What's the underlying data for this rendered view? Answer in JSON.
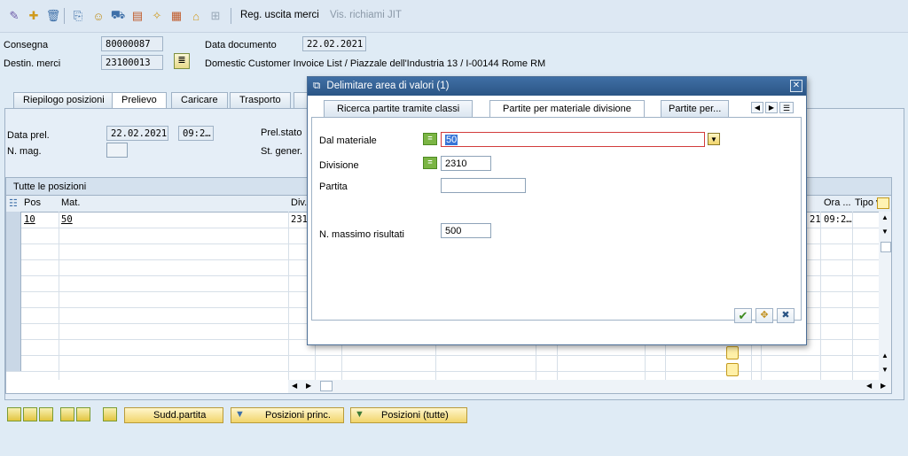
{
  "toolbar": {
    "reg_uscita_merci": "Reg. uscita merci",
    "vis_richiami_jit": "Vis. richiami JIT"
  },
  "header": {
    "consegna_label": "Consegna",
    "consegna_value": "80000087",
    "data_documento_label": "Data documento",
    "data_documento_value": "22.02.2021",
    "destin_merci_label": "Destin. merci",
    "destin_merci_value": "23100013",
    "destin_merci_desc": "Domestic Customer Invoice List / Piazzale dell'Industria 13 / I-00144 Rome RM"
  },
  "tabs": [
    "Riepilogo posizioni",
    "Prelievo",
    "Caricare",
    "Trasporto"
  ],
  "panel": {
    "data_prel_label": "Data prel.",
    "data_prel_value": "22.02.2021",
    "data_prel_time": "09:2…",
    "n_mag_label": "N. mag.",
    "prel_stato_label": "Prel.stato",
    "st_gener_label": "St. gener."
  },
  "table": {
    "title": "Tutte le posizioni",
    "headers": {
      "pos": "Pos",
      "mat": "Mat.",
      "div": "Div.",
      "ora": "Ora ...",
      "tipo_va": "Tipo va"
    },
    "row1": {
      "pos": "10",
      "mat": "50",
      "div": "231",
      "date_tail": "21",
      "ora": "09:2…"
    }
  },
  "bottom_buttons": {
    "sudd_partita": "Sudd.partita",
    "posizioni_princ": "Posizioni princ.",
    "posizioni_tutte": "Posizioni (tutte)"
  },
  "dialog": {
    "title": "Delimitare area di valori (1)",
    "tabs": [
      "Ricerca partite tramite classi",
      "Partite per materiale divisione",
      "Partite per..."
    ],
    "dal_materiale_label": "Dal materiale",
    "dal_materiale_value": "50",
    "divisione_label": "Divisione",
    "divisione_value": "2310",
    "partita_label": "Partita",
    "partita_value": "",
    "n_massimo_label": "N. massimo risultati",
    "n_massimo_value": "500",
    "equal_sign": "="
  }
}
